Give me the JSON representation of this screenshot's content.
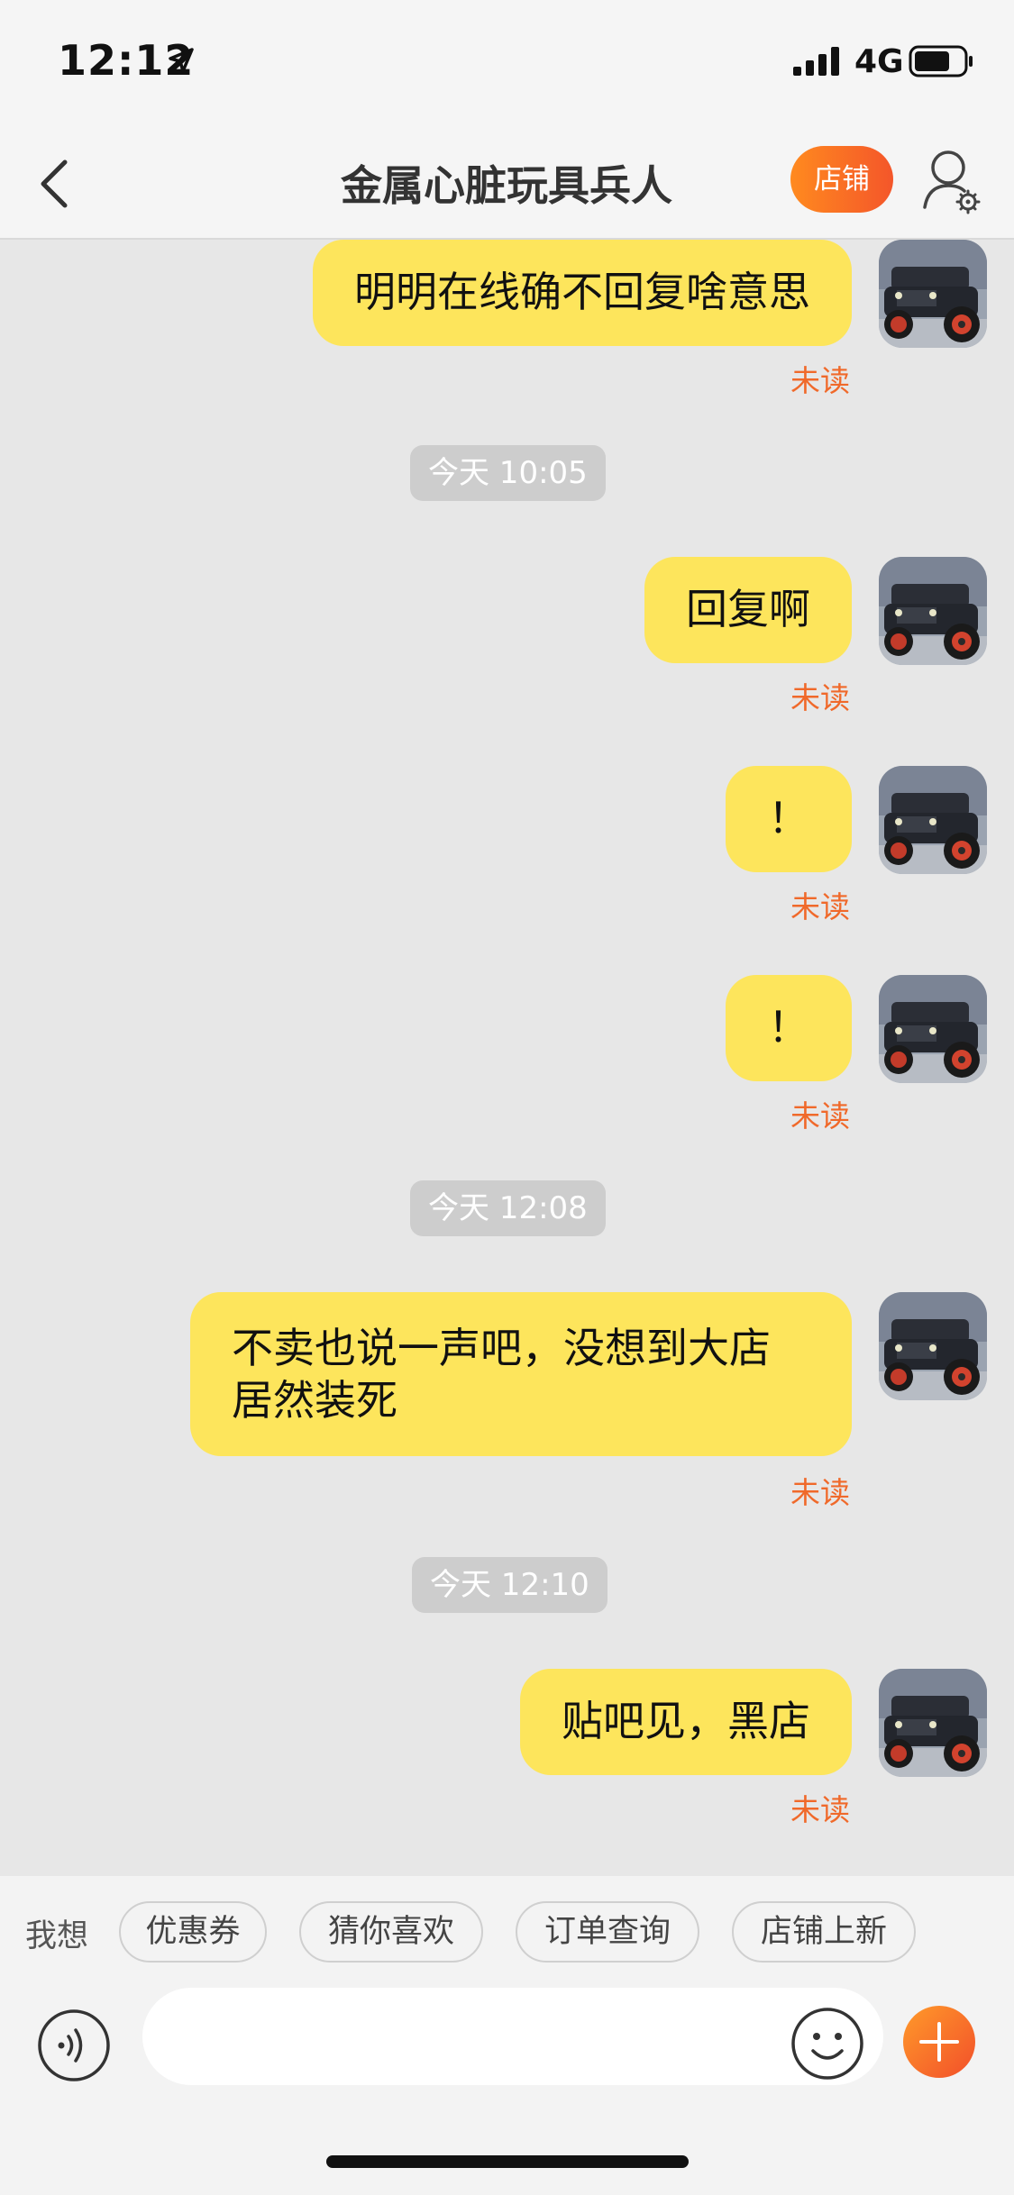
{
  "status_bar": {
    "time": "12:12",
    "network": "4G"
  },
  "header": {
    "title": "金属心脏玩具兵人",
    "store_button": "店铺"
  },
  "messages": [
    {
      "text": "明明在线确不回复啥意思",
      "status": "未读"
    },
    {
      "timestamp": "今天 10:05"
    },
    {
      "text": "回复啊",
      "status": "未读"
    },
    {
      "text": "！",
      "status": "未读"
    },
    {
      "text": "！",
      "status": "未读"
    },
    {
      "timestamp": "今天 12:08"
    },
    {
      "text": "不卖也说一声吧，没想到大店居然装死",
      "status": "未读"
    },
    {
      "timestamp": "今天 12:10"
    },
    {
      "text": "贴吧见，黑店",
      "status": "未读"
    }
  ],
  "quick_bar": {
    "label": "我想",
    "chips": [
      "优惠券",
      "猜你喜欢",
      "订单查询",
      "店铺上新"
    ]
  },
  "input": {
    "placeholder": ""
  },
  "colors": {
    "bubble": "#fde55c",
    "unread": "#f0692a",
    "accent": "#f4562a"
  }
}
